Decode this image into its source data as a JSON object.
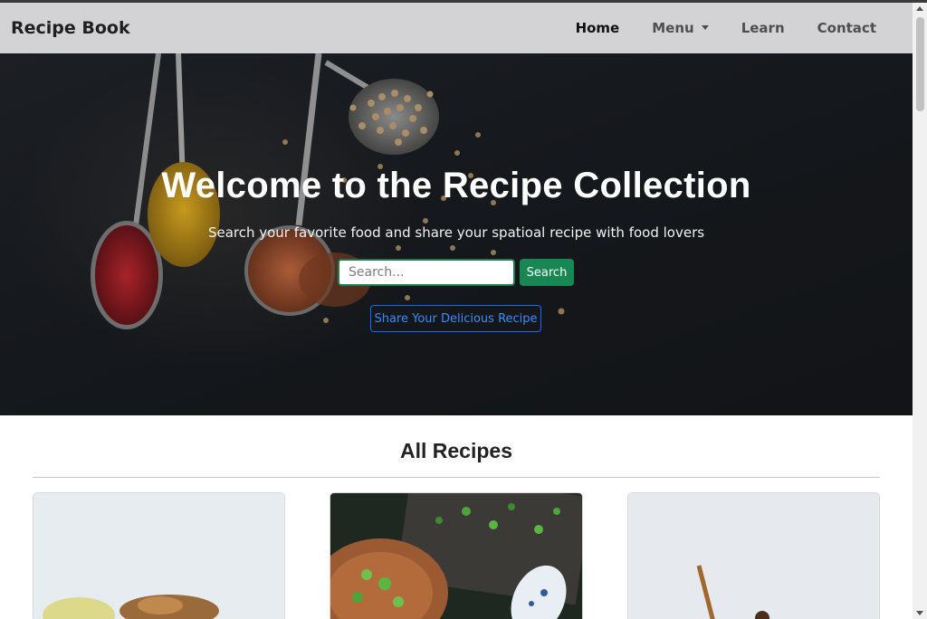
{
  "navbar": {
    "brand": "Recipe Book",
    "items": [
      {
        "label": "Home",
        "active": true
      },
      {
        "label": "Menu",
        "dropdown": true
      },
      {
        "label": "Learn"
      },
      {
        "label": "Contact"
      }
    ]
  },
  "hero": {
    "title": "Welcome to the Recipe Collection",
    "subtitle": "Search your favorite food and share your spatioal recipe with food lovers",
    "search_placeholder": "Search...",
    "search_button": "Search",
    "share_button": "Share Your Delicious Recipe"
  },
  "recipes": {
    "title": "All Recipes"
  },
  "colors": {
    "navbar_bg": "#d3d3d5",
    "search_green": "#198754",
    "share_blue": "#0d6efd"
  }
}
